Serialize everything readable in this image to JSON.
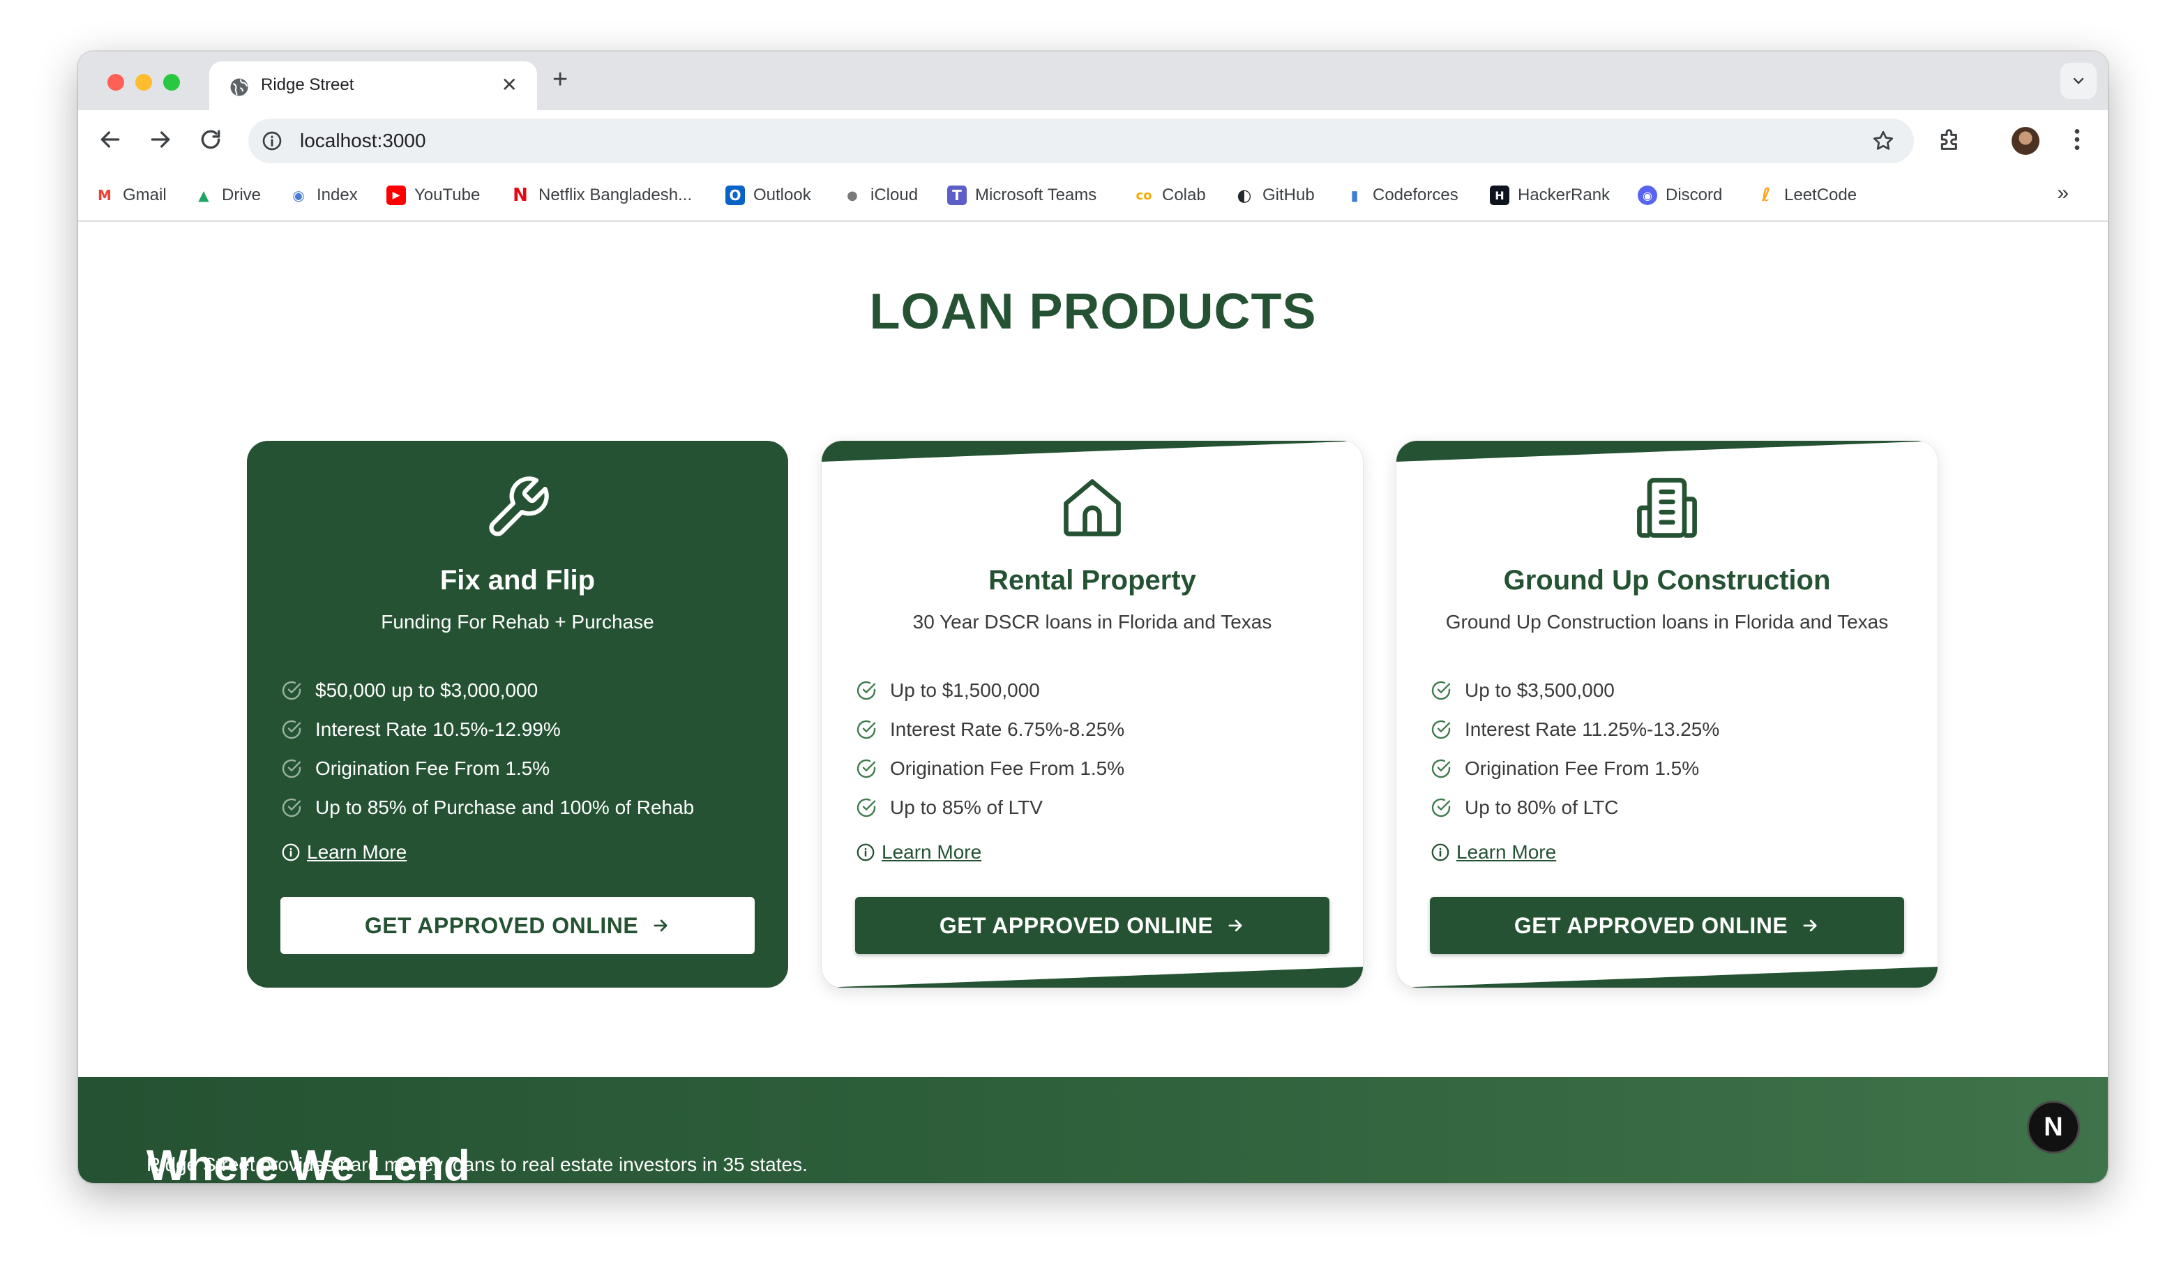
{
  "colors": {
    "brand_green": "#245232",
    "white": "#ffffff"
  },
  "browser": {
    "tab": {
      "title": "Ridge Street",
      "favicon": "globe-icon"
    },
    "url": "localhost:3000",
    "bookmarks": [
      {
        "label": "Gmail",
        "icon": "gmail-icon",
        "glyph": "M",
        "color": "#ea4335"
      },
      {
        "label": "Drive",
        "icon": "drive-icon",
        "glyph": "▲",
        "color": "#1fa463"
      },
      {
        "label": "Index",
        "icon": "index-icon",
        "glyph": "◉",
        "color": "#4a7bd0"
      },
      {
        "label": "YouTube",
        "icon": "youtube-icon",
        "glyph": "▶",
        "color": "#ff0000"
      },
      {
        "label": "Netflix Bangladesh...",
        "icon": "netflix-icon",
        "glyph": "N",
        "color": "#e50914"
      },
      {
        "label": "Outlook",
        "icon": "outlook-icon",
        "glyph": "O",
        "color": "#0a64c8"
      },
      {
        "label": "iCloud",
        "icon": "apple-icon",
        "glyph": "●",
        "color": "#7a7a7a"
      },
      {
        "label": "Microsoft Teams",
        "icon": "teams-icon",
        "glyph": "T",
        "color": "#5b5fc7"
      },
      {
        "label": "Colab",
        "icon": "colab-icon",
        "glyph": "co",
        "color": "#f9ab00"
      },
      {
        "label": "GitHub",
        "icon": "github-icon",
        "glyph": "◐",
        "color": "#24292f"
      },
      {
        "label": "Codeforces",
        "icon": "codeforces-icon",
        "glyph": "▮",
        "color": "#3b7dd8"
      },
      {
        "label": "HackerRank",
        "icon": "hackerrank-icon",
        "glyph": "H",
        "color": "#0e141e"
      },
      {
        "label": "Discord",
        "icon": "discord-icon",
        "glyph": "◉",
        "color": "#5865f2"
      },
      {
        "label": "LeetCode",
        "icon": "leetcode-icon",
        "glyph": "ℓ",
        "color": "#ffa116"
      }
    ]
  },
  "page": {
    "section_title": "LOAN PRODUCTS",
    "cards": [
      {
        "icon": "wrench-icon",
        "title": "Fix and Flip",
        "subtitle": "Funding For Rehab + Purchase",
        "features": [
          "$50,000 up to $3,000,000",
          "Interest Rate 10.5%-12.99%",
          "Origination Fee From 1.5%",
          "Up to 85% of Purchase and 100% of Rehab"
        ],
        "learn_more": "Learn More",
        "cta": "GET APPROVED ONLINE"
      },
      {
        "icon": "house-icon",
        "title": "Rental Property",
        "subtitle": "30 Year DSCR loans in Florida and Texas",
        "features": [
          "Up to $1,500,000",
          "Interest Rate 6.75%-8.25%",
          "Origination Fee From 1.5%",
          "Up to 85% of LTV"
        ],
        "learn_more": "Learn More",
        "cta": "GET APPROVED ONLINE"
      },
      {
        "icon": "building-icon",
        "title": "Ground Up Construction",
        "subtitle": "Ground Up Construction loans in Florida and Texas",
        "features": [
          "Up to $3,500,000",
          "Interest Rate 11.25%-13.25%",
          "Origination Fee From 1.5%",
          "Up to 80% of LTC"
        ],
        "learn_more": "Learn More",
        "cta": "GET APPROVED ONLINE"
      }
    ],
    "lend": {
      "title": "Where We Lend",
      "text": "Ridge Street provides hard money loans to real estate investors in 35 states."
    },
    "dev_badge": "N"
  }
}
